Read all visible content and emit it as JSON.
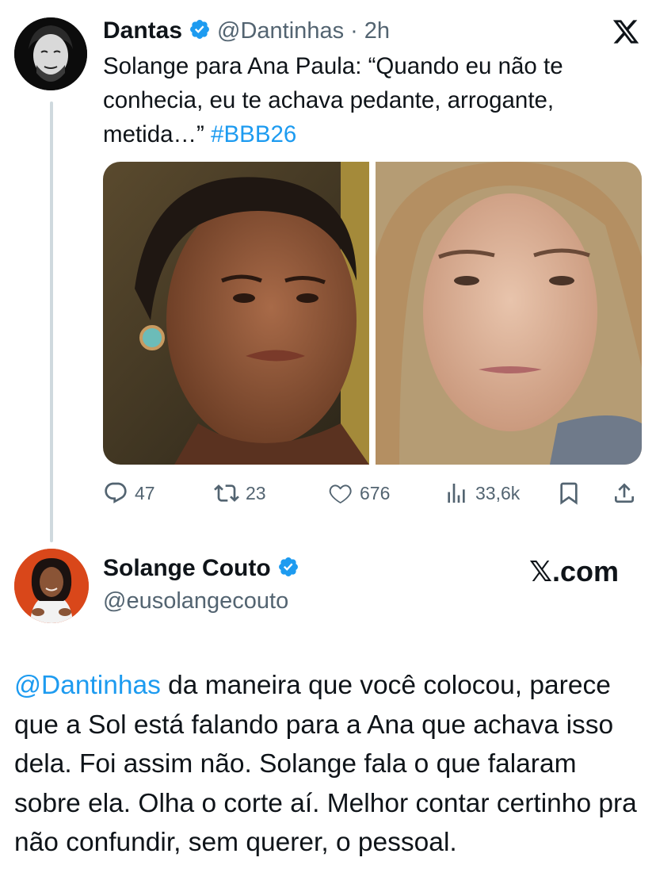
{
  "tweet1": {
    "name": "Dantas",
    "handle": "@Dantinhas",
    "separator": "·",
    "time": "2h",
    "text_main": "Solange para Ana Paula: “Quando eu não te conhecia, eu te achava pedante, arrogante, metida…”",
    "hashtag": "#BBB26",
    "actions": {
      "replies": "47",
      "reposts": "23",
      "likes": "676",
      "views": "33,6k"
    }
  },
  "tweet2": {
    "name": "Solange Couto",
    "handle": "@eusolangecouto",
    "brand": "𝕏.com",
    "mention": "@Dantinhas",
    "text": " da maneira que você colocou, parece que a Sol está falando para a Ana que achava isso dela. Foi assim não. Solange fala o que falaram sobre ela. Olha o corte aí. Melhor contar certinho pra não confundir, sem querer, o pessoal."
  },
  "colors": {
    "accent": "#1d9bf0",
    "secondary_text": "#536471",
    "thread_line": "#cfd9de"
  },
  "icons": [
    "x-logo-icon",
    "verified-icon",
    "reply-icon",
    "repost-icon",
    "like-icon",
    "views-icon",
    "bookmark-icon",
    "share-icon"
  ]
}
